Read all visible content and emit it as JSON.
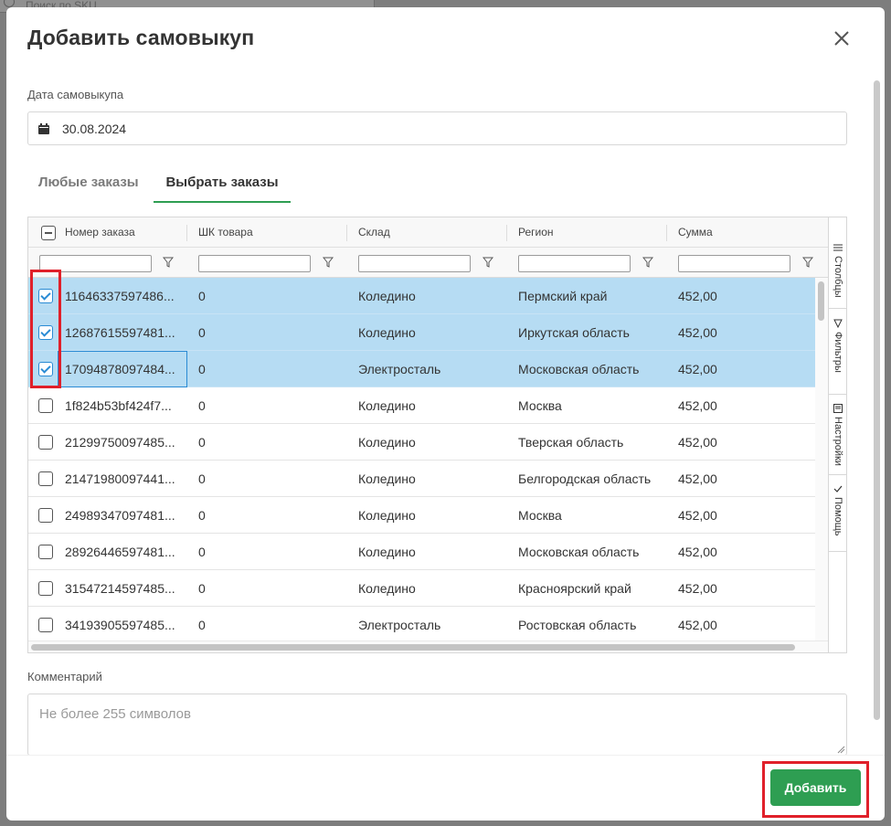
{
  "background": {
    "search_placeholder": "Поиск по SKU"
  },
  "modal": {
    "title": "Добавить самовыкуп",
    "close_icon": "close-icon"
  },
  "date": {
    "label": "Дата самовыкупа",
    "value": "30.08.2024",
    "icon": "calendar-icon"
  },
  "tabs": [
    {
      "label": "Любые заказы",
      "active": false
    },
    {
      "label": "Выбрать заказы",
      "active": true
    }
  ],
  "grid": {
    "columns": [
      "Номер заказа",
      "ШК товара",
      "Склад",
      "Регион",
      "Сумма"
    ],
    "rows": [
      {
        "order": "11646337597486...",
        "sku": "0",
        "warehouse": "Коледино",
        "region": "Пермский край",
        "sum": "452,00",
        "selected": true
      },
      {
        "order": "12687615597481...",
        "sku": "0",
        "warehouse": "Коледино",
        "region": "Иркутская область",
        "sum": "452,00",
        "selected": true
      },
      {
        "order": "17094878097484...",
        "sku": "0",
        "warehouse": "Электросталь",
        "region": "Московская область",
        "sum": "452,00",
        "selected": true
      },
      {
        "order": "1f824b53bf424f7...",
        "sku": "0",
        "warehouse": "Коледино",
        "region": "Москва",
        "sum": "452,00",
        "selected": false
      },
      {
        "order": "21299750097485...",
        "sku": "0",
        "warehouse": "Коледино",
        "region": "Тверская область",
        "sum": "452,00",
        "selected": false
      },
      {
        "order": "21471980097441...",
        "sku": "0",
        "warehouse": "Коледино",
        "region": "Белгородская область",
        "sum": "452,00",
        "selected": false
      },
      {
        "order": "24989347097481...",
        "sku": "0",
        "warehouse": "Коледино",
        "region": "Москва",
        "sum": "452,00",
        "selected": false
      },
      {
        "order": "28926446597481...",
        "sku": "0",
        "warehouse": "Коледино",
        "region": "Московская область",
        "sum": "452,00",
        "selected": false
      },
      {
        "order": "31547214597485...",
        "sku": "0",
        "warehouse": "Коледино",
        "region": "Красноярский край",
        "sum": "452,00",
        "selected": false
      },
      {
        "order": "34193905597485...",
        "sku": "0",
        "warehouse": "Электросталь",
        "region": "Ростовская область",
        "sum": "452,00",
        "selected": false
      }
    ],
    "side_panel": [
      "Столбцы",
      "Фильтры",
      "Настройки",
      "Помощь"
    ]
  },
  "comment": {
    "label": "Комментарий",
    "placeholder": "Не более 255 символов"
  },
  "actions": {
    "add_label": "Добавить"
  },
  "colors": {
    "accent_green": "#2e9e52",
    "row_selected": "#b6dcf3",
    "checkbox_blue": "#2a8bd4",
    "highlight_red": "#e0202a"
  }
}
